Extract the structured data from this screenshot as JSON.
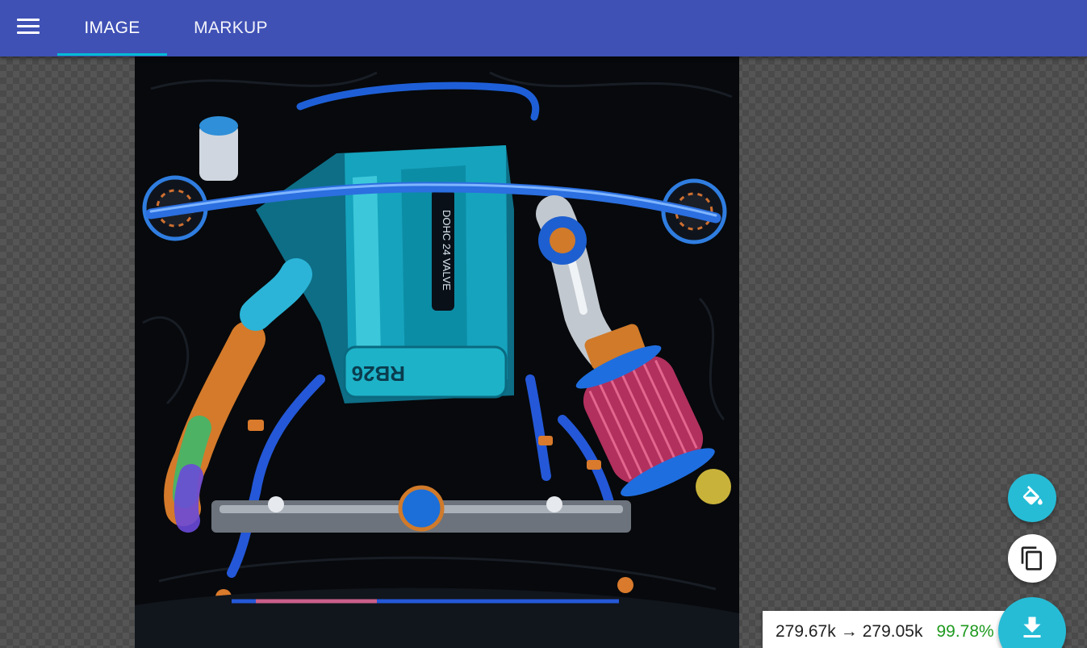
{
  "tabs": [
    {
      "label": "IMAGE",
      "active": true
    },
    {
      "label": "MARKUP",
      "active": false
    }
  ],
  "accent_color": "#00bcd4",
  "appbar_color": "#3f51b5",
  "preview": {
    "subject": "vectorized engine bay illustration",
    "engine_badge": "RB26"
  },
  "stats": {
    "original_size": "279.67k",
    "arrow": "→",
    "optimized_size": "279.05k",
    "percent": "99.78%"
  },
  "icons": {
    "menu": "hamburger-menu-icon",
    "theme": "paint-bucket-icon",
    "copy": "copy-icon",
    "download": "download-icon"
  }
}
